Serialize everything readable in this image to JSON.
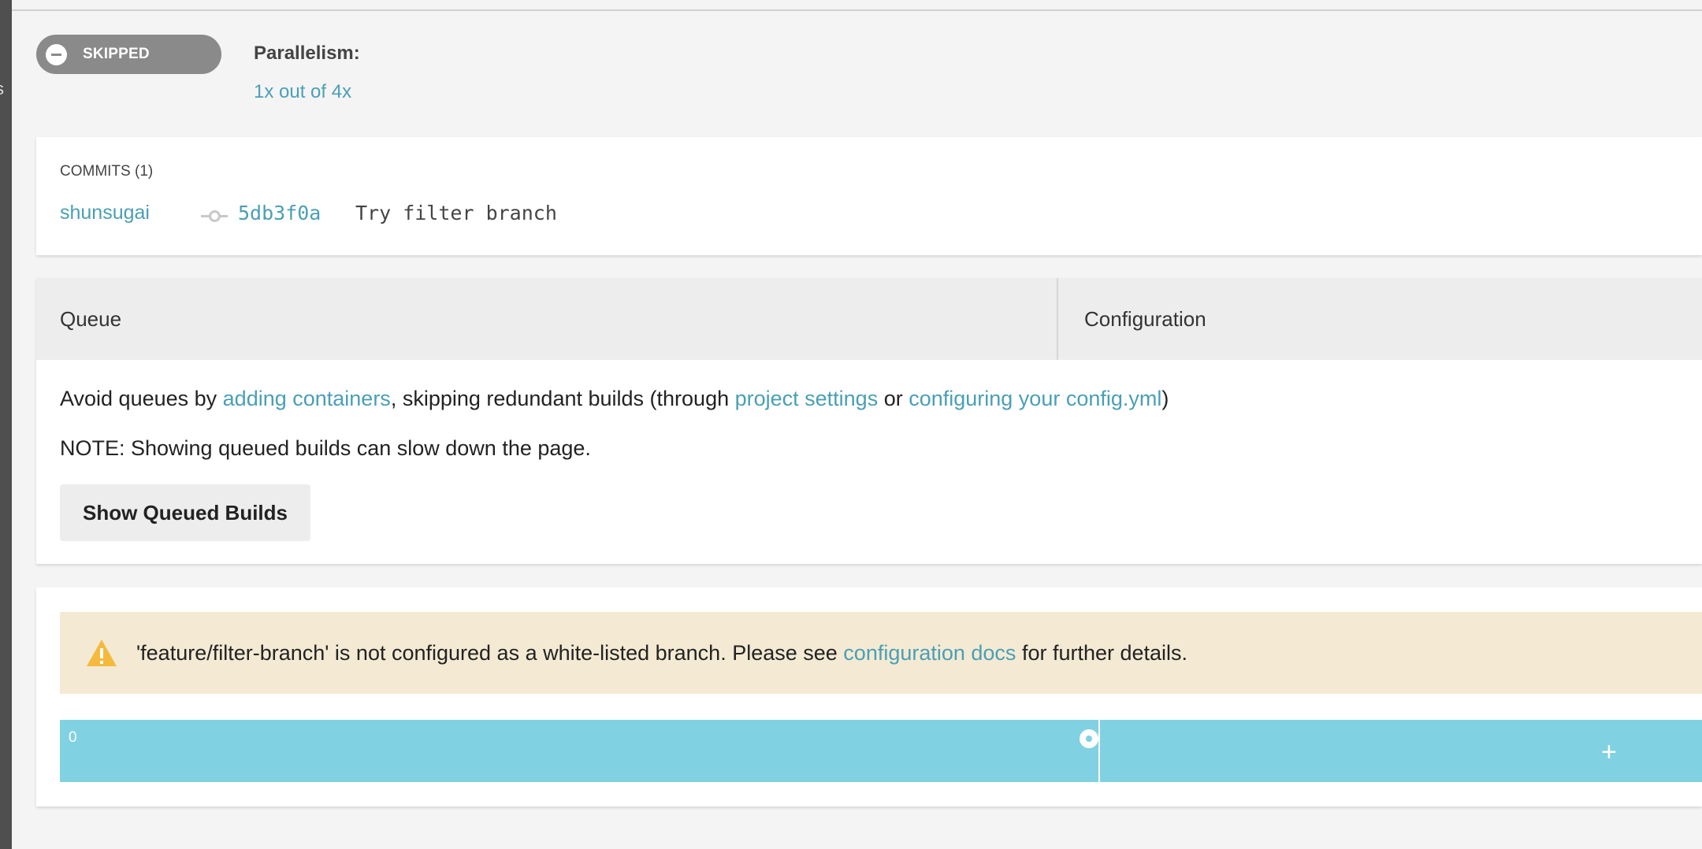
{
  "sidebar": {
    "letter": "s"
  },
  "status": {
    "label": "SKIPPED",
    "icon": "minus-circle-icon",
    "color": "#8a8a8a"
  },
  "parallelism": {
    "label": "Parallelism:",
    "value": "1x out of 4x"
  },
  "commits": {
    "title": "COMMITS (1)",
    "items": [
      {
        "author": "shunsugai",
        "sha": "5db3f0a",
        "message": "Try filter branch"
      }
    ]
  },
  "tabs": [
    {
      "label": "Queue"
    },
    {
      "label": "Configuration"
    }
  ],
  "queue": {
    "line1": {
      "pre": "Avoid queues by ",
      "link1": "adding containers",
      "mid1": ", skipping redundant builds (through ",
      "link2": "project settings",
      "mid2": " or ",
      "link3": "configuring your config.yml",
      "post": ")"
    },
    "note": "NOTE: Showing queued builds can slow down the page.",
    "button": "Show Queued Builds"
  },
  "warning": {
    "icon": "warning-triangle-icon",
    "pre": "'feature/filter-branch' is not configured as a white-listed branch. Please see ",
    "link": "configuration docs",
    "post": " for further details."
  },
  "container_bar": {
    "index": "0",
    "add_icon": "+",
    "color": "#80d1e2"
  },
  "colors": {
    "link": "#4a9fb5",
    "background": "#f4f4f4",
    "warning_bg": "#f4ead4"
  }
}
